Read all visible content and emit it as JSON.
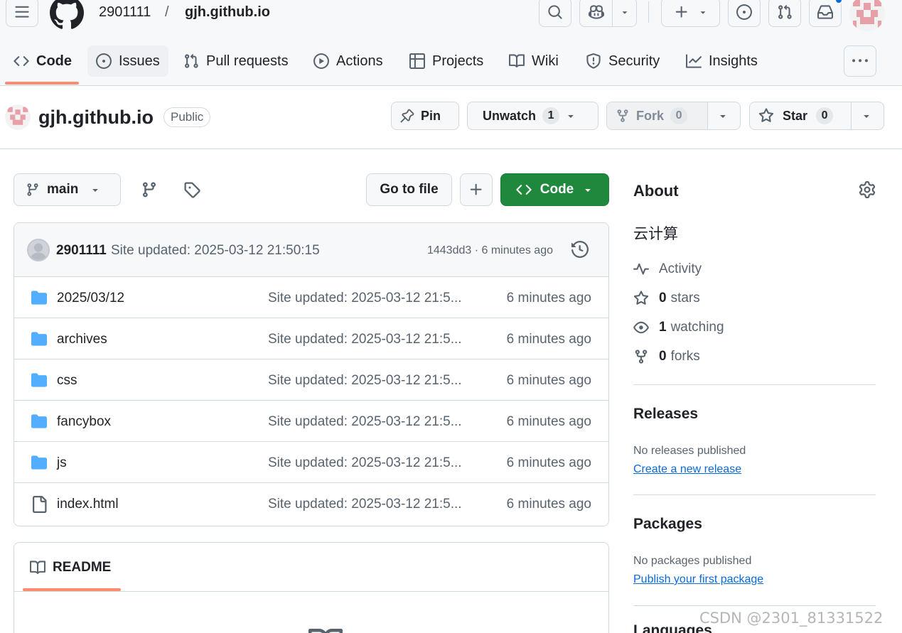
{
  "header": {
    "owner": "2901111",
    "separator": "/",
    "repo": "gjh.github.io"
  },
  "tabs": [
    {
      "label": "Code",
      "icon": "code-icon"
    },
    {
      "label": "Issues",
      "icon": "issue-icon"
    },
    {
      "label": "Pull requests",
      "icon": "pull-request-icon"
    },
    {
      "label": "Actions",
      "icon": "play-icon"
    },
    {
      "label": "Projects",
      "icon": "table-icon"
    },
    {
      "label": "Wiki",
      "icon": "book-icon"
    },
    {
      "label": "Security",
      "icon": "shield-icon"
    },
    {
      "label": "Insights",
      "icon": "graph-icon"
    }
  ],
  "repo": {
    "name": "gjh.github.io",
    "visibility": "Public",
    "pin_label": "Pin",
    "watch_label": "Unwatch",
    "watch_count": "1",
    "fork_label": "Fork",
    "fork_count": "0",
    "star_label": "Star",
    "star_count": "0"
  },
  "toolbar": {
    "branch": "main",
    "goto_file": "Go to file",
    "code_label": "Code"
  },
  "commit": {
    "user": "2901111",
    "message": "Site updated: 2025-03-12 21:50:15",
    "meta": "1443dd3 · 6 minutes ago"
  },
  "files": [
    {
      "name": "2025/03/12",
      "type": "folder",
      "message": "Site updated: 2025-03-12 21:5...",
      "age": "6 minutes ago"
    },
    {
      "name": "archives",
      "type": "folder",
      "message": "Site updated: 2025-03-12 21:5...",
      "age": "6 minutes ago"
    },
    {
      "name": "css",
      "type": "folder",
      "message": "Site updated: 2025-03-12 21:5...",
      "age": "6 minutes ago"
    },
    {
      "name": "fancybox",
      "type": "folder",
      "message": "Site updated: 2025-03-12 21:5...",
      "age": "6 minutes ago"
    },
    {
      "name": "js",
      "type": "folder",
      "message": "Site updated: 2025-03-12 21:5...",
      "age": "6 minutes ago"
    },
    {
      "name": "index.html",
      "type": "file",
      "message": "Site updated: 2025-03-12 21:5...",
      "age": "6 minutes ago"
    }
  ],
  "readme": {
    "label": "README"
  },
  "about": {
    "title": "About",
    "description": "云计算",
    "activity": "Activity",
    "stars_count": "0",
    "stars_label": "stars",
    "watching_count": "1",
    "watching_label": "watching",
    "forks_count": "0",
    "forks_label": "forks"
  },
  "releases": {
    "title": "Releases",
    "note": "No releases published",
    "link": "Create a new release"
  },
  "packages": {
    "title": "Packages",
    "note": "No packages published",
    "link": "Publish your first package"
  },
  "languages": {
    "title": "Languages"
  },
  "watermark": "CSDN @2301_81331522",
  "colors": {
    "accent_underline": "#fd8c73",
    "code_button": "#1f883d",
    "link": "#0969da",
    "folder": "#54aeff"
  }
}
